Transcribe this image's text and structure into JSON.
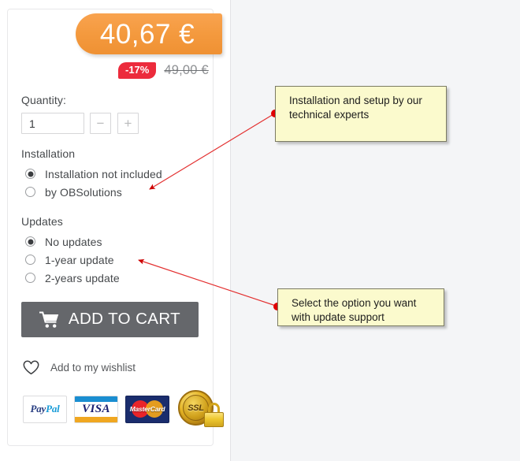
{
  "product": {
    "price": {
      "current": "40,67 €",
      "discount_badge": "-17%",
      "old_price": "49,00 €",
      "badge_color": "#f49a3f",
      "discount_color": "#ec2b3c"
    },
    "quantity": {
      "label": "Quantity:",
      "value": "1",
      "decrease_label": "−",
      "increase_label": "+"
    },
    "installation": {
      "label": "Installation",
      "options": [
        {
          "label": "Installation not included",
          "selected": true
        },
        {
          "label": "by OBSolutions",
          "selected": false
        }
      ]
    },
    "updates": {
      "label": "Updates",
      "options": [
        {
          "label": "No updates",
          "selected": true
        },
        {
          "label": "1-year update",
          "selected": false
        },
        {
          "label": "2-years update",
          "selected": false
        }
      ]
    },
    "add_to_cart": {
      "label": "ADD TO CART",
      "icon": "shopping-cart-icon",
      "color": "#65676b"
    },
    "wishlist": {
      "label": "Add to my wishlist",
      "icon": "heart-icon"
    },
    "payment_badges": [
      {
        "name": "paypal",
        "text_pay": "Pay",
        "text_pal": "Pal"
      },
      {
        "name": "visa",
        "text": "VISA"
      },
      {
        "name": "mastercard",
        "text": "MasterCard"
      },
      {
        "name": "ssl",
        "text": "SSL"
      }
    ]
  },
  "annotations": [
    {
      "id": "installation-note",
      "text": "Installation and setup by our technical experts",
      "marker_color": "#e00000",
      "background": "#fbfacd"
    },
    {
      "id": "updates-note",
      "text": "Select the option you want with update support",
      "marker_color": "#e00000",
      "background": "#fbfacd"
    }
  ]
}
